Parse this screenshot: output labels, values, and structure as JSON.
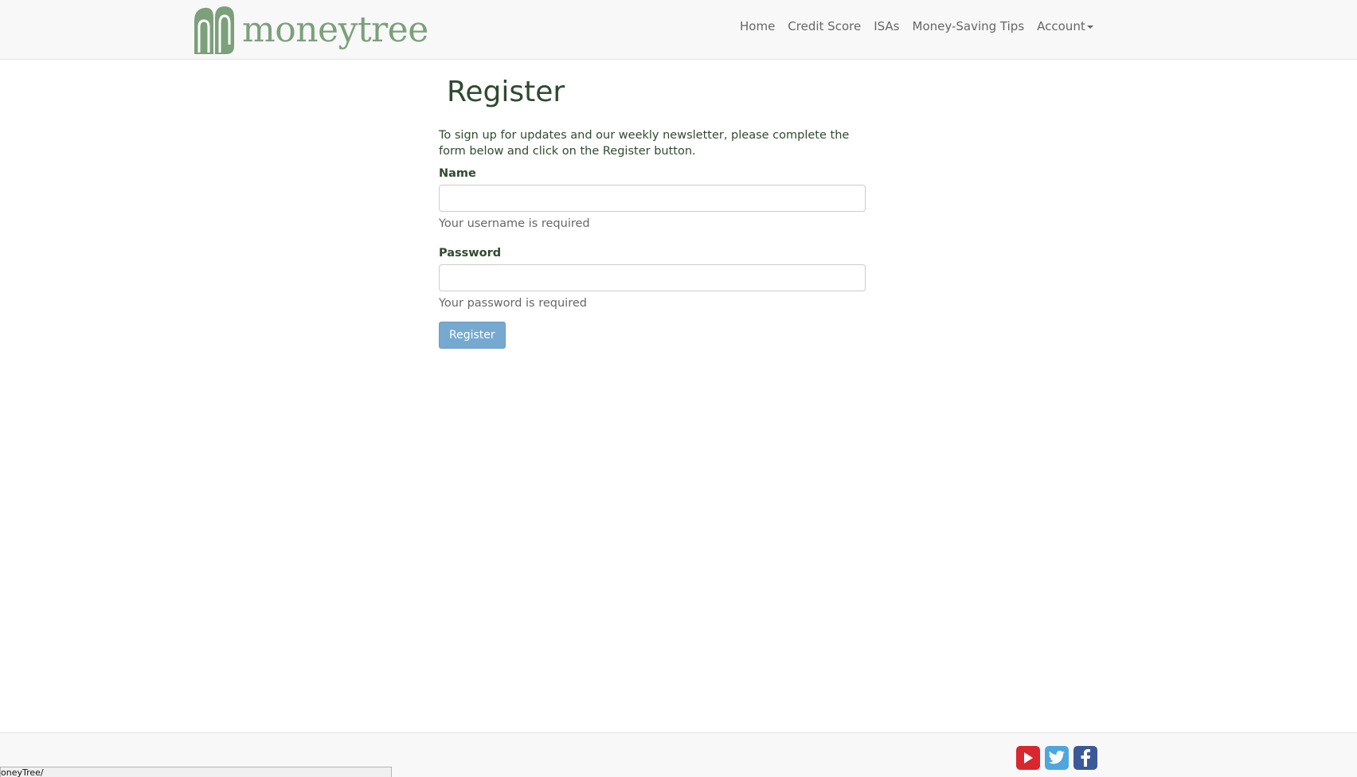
{
  "brand": {
    "name": "moneytree",
    "color": "#7ba07b"
  },
  "nav": {
    "items": [
      "Home",
      "Credit Score",
      "ISAs",
      "Money-Saving Tips"
    ],
    "account_label": "Account"
  },
  "page": {
    "title": "Register",
    "intro": "To sign up for updates and our weekly newsletter, please complete the form below and click on the Register button."
  },
  "form": {
    "name_label": "Name",
    "name_value": "",
    "name_help": "Your username is required",
    "password_label": "Password",
    "password_value": "",
    "password_help": "Your password is required",
    "submit_label": "Register"
  },
  "footer": {
    "social": [
      "youtube-icon",
      "twitter-icon",
      "facebook-icon"
    ]
  },
  "status_bar": {
    "url": "oneyTree/"
  },
  "colors": {
    "heading": "#2f4a2f",
    "button": "#76a9d0",
    "youtube": "#d9272e",
    "twitter": "#4da7de",
    "facebook": "#3b5998"
  }
}
